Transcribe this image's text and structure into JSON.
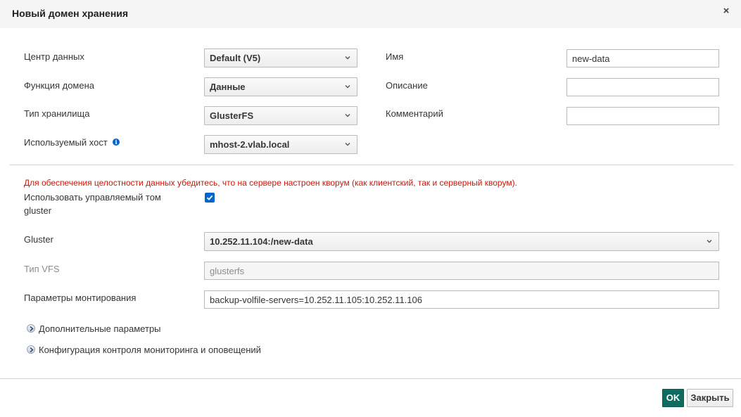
{
  "dialog": {
    "title": "Новый домен хранения",
    "close_icon": "×"
  },
  "left_fields": {
    "datacenter": {
      "label": "Центр данных",
      "value": "Default (V5)"
    },
    "domain_function": {
      "label": "Функция домена",
      "value": "Данные"
    },
    "storage_type": {
      "label": "Тип хранилища",
      "value": "GlusterFS"
    },
    "host": {
      "label": "Используемый хост",
      "value": "mhost-2.vlab.local",
      "info_icon": "i"
    }
  },
  "right_fields": {
    "name": {
      "label": "Имя",
      "value": "new-data"
    },
    "description": {
      "label": "Описание",
      "value": ""
    },
    "comment": {
      "label": "Комментарий",
      "value": ""
    }
  },
  "warning": "Для обеспечения целостности данных убедитесь, что на сервере настроен кворум (как клиентский, так и серверный кворум).",
  "managed_volume": {
    "label_line1": "Использовать управляемый том",
    "label_line2": "gluster",
    "checked": true
  },
  "gluster": {
    "label": "Gluster",
    "value": "10.252.11.104:/new-data"
  },
  "vfs_type": {
    "label": "Тип VFS",
    "value": "glusterfs"
  },
  "mount_options": {
    "label": "Параметры монтирования",
    "value": "backup-volfile-servers=10.252.11.105:10.252.11.106"
  },
  "expanders": {
    "advanced": "Дополнительные параметры",
    "monitoring": "Конфигурация контроля мониторинга и оповещений"
  },
  "buttons": {
    "ok": "OK",
    "close": "Закрыть"
  },
  "colors": {
    "ok_button": "#0f6b60",
    "warning": "#c9190b",
    "checkbox": "#0066cc"
  }
}
